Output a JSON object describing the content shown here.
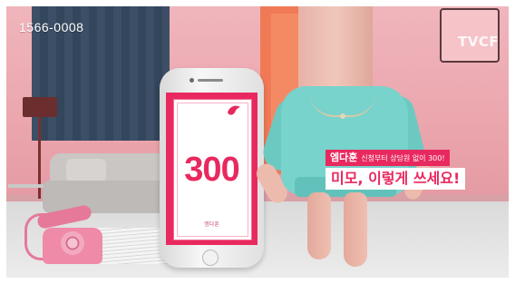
{
  "broadcast": {
    "phone_number": "1566-0008",
    "channel_watermark": "TVCF"
  },
  "product_screen": {
    "amount": "300",
    "brand_text": "엠다훈"
  },
  "caption": {
    "line1_brand": "엠다훈",
    "line1_text": "신청부터 상담원 없이 300!",
    "line2_text": "미모, 이렇게 쓰세요!"
  },
  "colors": {
    "accent_pink": "#e8295f",
    "wall_pink": "#eaa3ab",
    "sweater_teal": "#77d3cc"
  }
}
